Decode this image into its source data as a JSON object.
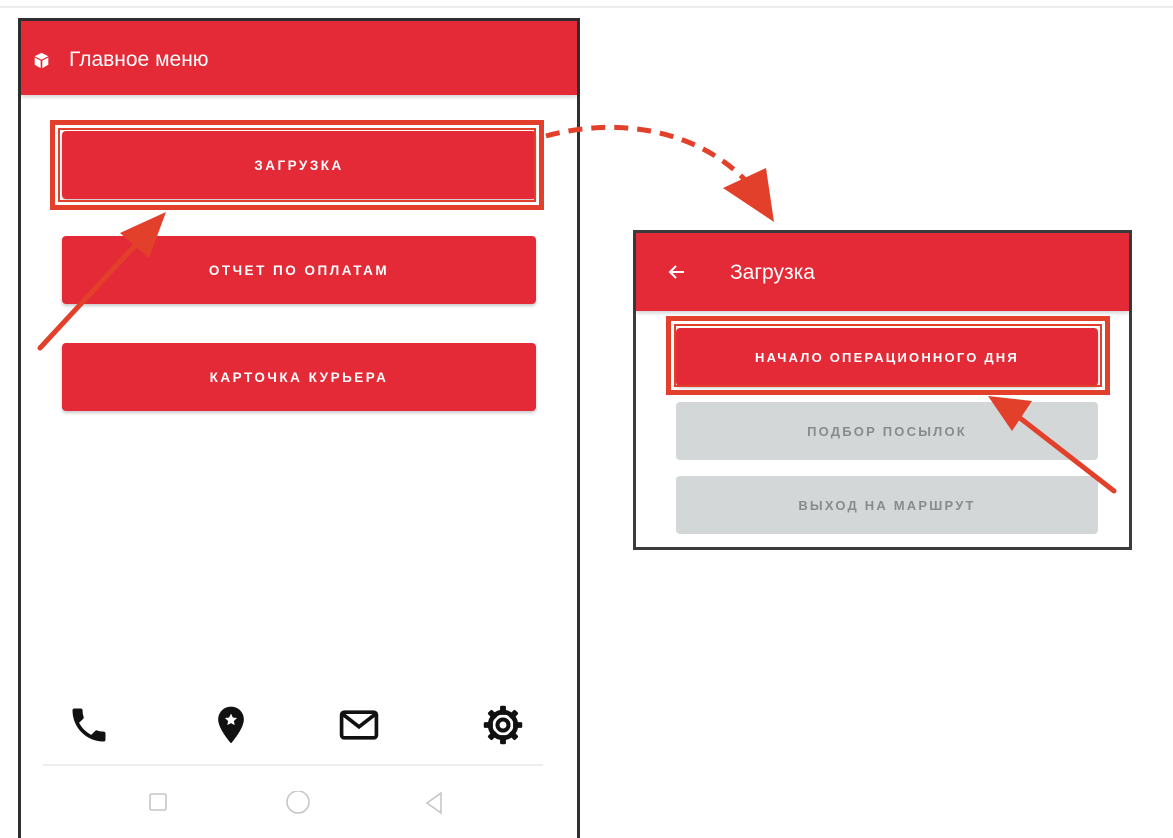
{
  "left_screen": {
    "title": "Главное меню",
    "menu_buttons": [
      "ЗАГРУЗКА",
      "ОТЧЕТ ПО ОПЛАТАМ",
      "КАРТОЧКА КУРЬЕРА"
    ],
    "bottom_icons": [
      "phone-icon",
      "map-pin-icon",
      "mail-icon",
      "gear-icon"
    ],
    "system_nav": [
      "square-icon",
      "circle-icon",
      "back-triangle-icon"
    ]
  },
  "right_screen": {
    "title": "Загрузка",
    "back_icon": "arrow-left-icon",
    "buttons": [
      {
        "label": "НАЧАЛО ОПЕРАЦИОННОГО ДНЯ",
        "state": "active"
      },
      {
        "label": "ПОДБОР ПОСЫЛОК",
        "state": "disabled"
      },
      {
        "label": "ВЫХОД НА МАРШРУТ",
        "state": "disabled"
      }
    ]
  },
  "colors": {
    "brand_red": "#e52a37",
    "highlight_orange": "#e3402b",
    "disabled_gray": "#d4d7d7"
  }
}
